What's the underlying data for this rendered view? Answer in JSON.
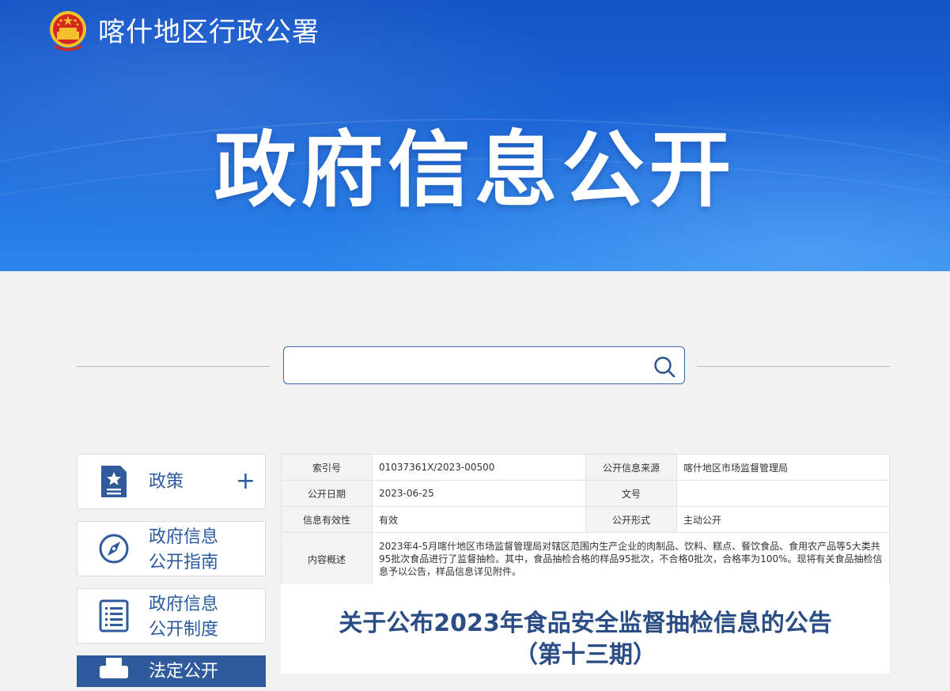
{
  "header": {
    "org_name": "喀什地区行政公署",
    "hero_title": "政府信息公开"
  },
  "search": {
    "placeholder": "",
    "icon": "search-icon"
  },
  "sidebar": {
    "items": [
      {
        "label_line1": "政策",
        "label_line2": "",
        "icon": "policy-document-icon",
        "expandable": true
      },
      {
        "label_line1": "政府信息",
        "label_line2": "公开指南",
        "icon": "compass-icon"
      },
      {
        "label_line1": "政府信息",
        "label_line2": "公开制度",
        "icon": "list-document-icon"
      },
      {
        "label_line1": "法定公开",
        "label_line2": "",
        "icon": "printer-icon",
        "active": true
      }
    ]
  },
  "meta": {
    "index_label": "索引号",
    "index_value": "01037361X/2023-00500",
    "source_label": "公开信息来源",
    "source_value": "喀什地区市场监督管理局",
    "date_label": "公开日期",
    "date_value": "2023-06-25",
    "docno_label": "文号",
    "docno_value": "",
    "validity_label": "信息有效性",
    "validity_value": "有效",
    "form_label": "公开形式",
    "form_value": "主动公开",
    "summary_label": "内容概述",
    "summary_value": "2023年4-5月喀什地区市场监督管理局对辖区范围内生产企业的肉制品、饮料、糕点、餐饮食品、食用农产品等5大类共95批次食品进行了监督抽检。其中，食品抽检合格的样品95批次，不合格0批次，合格率为100%。现将有关食品抽检信息予以公告，样品信息详见附件。"
  },
  "article": {
    "title_line1": "关于公布2023年食品安全监督抽检信息的公告",
    "title_line2": "（第十三期）"
  },
  "colors": {
    "banner_top": "#1354c6",
    "banner_bottom": "#2a86ec",
    "accent": "#2a5aa0",
    "active_bg": "#2f5b9c"
  }
}
